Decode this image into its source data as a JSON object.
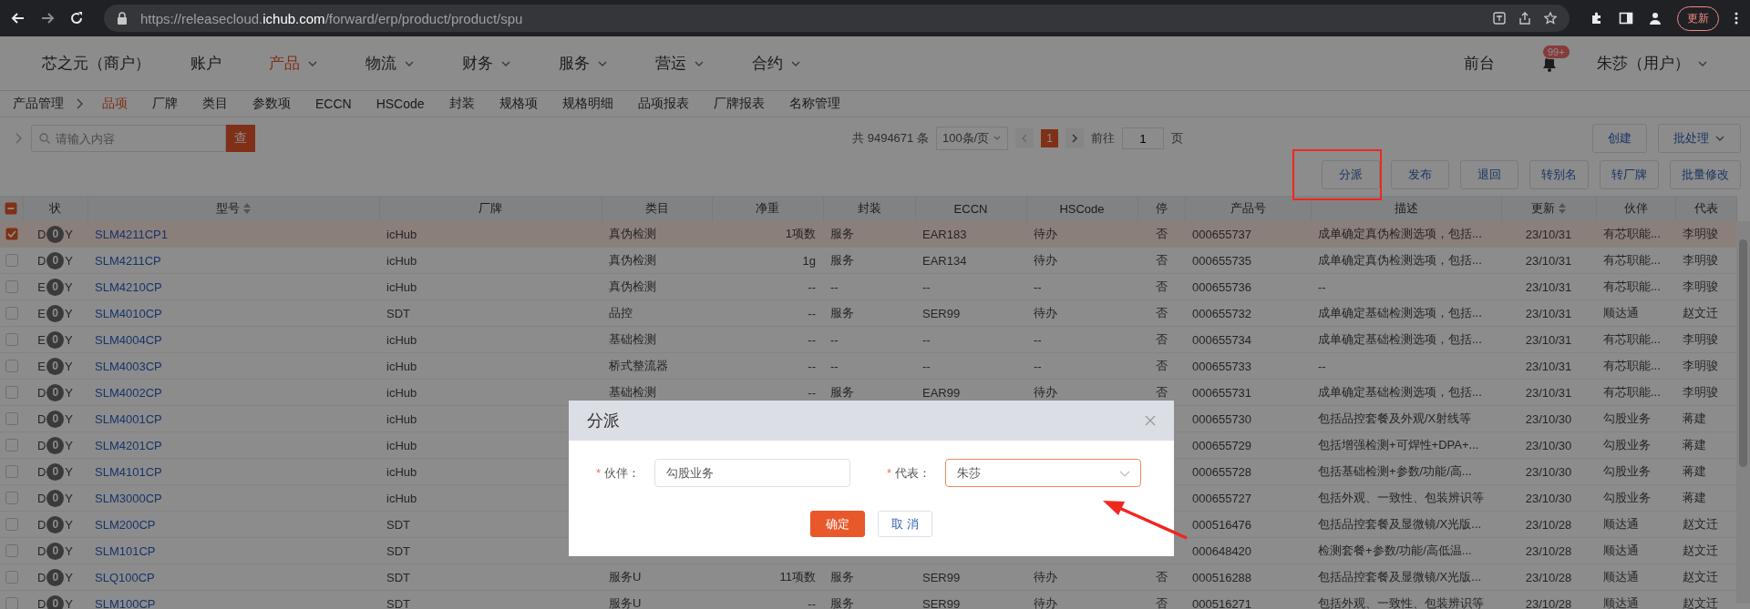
{
  "browser": {
    "url_host": "https://releasecloud.",
    "url_domain": "ichub.com",
    "url_path": "/forward/erp/product/product/spu",
    "update_button": "更新"
  },
  "nav": {
    "brand": "芯之元（商户）",
    "items": [
      {
        "label": "账户",
        "selected": false,
        "dropdown": false
      },
      {
        "label": "产品",
        "selected": true,
        "dropdown": true
      },
      {
        "label": "物流",
        "selected": false,
        "dropdown": true
      },
      {
        "label": "财务",
        "selected": false,
        "dropdown": true
      },
      {
        "label": "服务",
        "selected": false,
        "dropdown": true
      },
      {
        "label": "营运",
        "selected": false,
        "dropdown": true
      },
      {
        "label": "合约",
        "selected": false,
        "dropdown": true
      }
    ],
    "front_desk": "前台",
    "notification_badge": "99+",
    "user": "朱莎（用户）"
  },
  "breadcrumb": {
    "root": "产品管理",
    "tabs": [
      {
        "label": "品项",
        "selected": true
      },
      {
        "label": "厂牌",
        "selected": false
      },
      {
        "label": "类目",
        "selected": false
      },
      {
        "label": "参数项",
        "selected": false
      },
      {
        "label": "ECCN",
        "selected": false
      },
      {
        "label": "HSCode",
        "selected": false
      },
      {
        "label": "封装",
        "selected": false
      },
      {
        "label": "规格项",
        "selected": false
      },
      {
        "label": "规格明细",
        "selected": false
      },
      {
        "label": "品项报表",
        "selected": false
      },
      {
        "label": "厂牌报表",
        "selected": false
      },
      {
        "label": "名称管理",
        "selected": false
      }
    ]
  },
  "toolbar": {
    "search": {
      "placeholder": "请输入内容",
      "button": "查"
    },
    "pager": {
      "total": "共 9494671 条",
      "page_size": "100条/页",
      "pages": [
        {
          "label": "1",
          "selected": true
        }
      ],
      "goto_label": "前往",
      "goto_value": "1",
      "goto_suffix": "页"
    },
    "top_buttons": [
      {
        "label": "创建",
        "dropdown": false
      },
      {
        "label": "批处理",
        "dropdown": true
      }
    ],
    "actions": [
      "分派",
      "发布",
      "退回",
      "转别名",
      "转厂牌",
      "批量修改"
    ]
  },
  "table": {
    "header_checkbox": {
      "indeterminate": true
    },
    "columns": [
      {
        "label": "状",
        "sortable": false
      },
      {
        "label": "型号",
        "sortable": true
      },
      {
        "label": "厂牌",
        "sortable": false
      },
      {
        "label": "类目",
        "sortable": false
      },
      {
        "label": "净重",
        "sortable": false
      },
      {
        "label": "封装",
        "sortable": false
      },
      {
        "label": "ECCN",
        "sortable": false
      },
      {
        "label": "HSCode",
        "sortable": false
      },
      {
        "label": "停",
        "sortable": false
      },
      {
        "label": "产品号",
        "sortable": false
      },
      {
        "label": "描述",
        "sortable": false
      },
      {
        "label": "更新",
        "sortable": true
      },
      {
        "label": "伙伴",
        "sortable": false
      },
      {
        "label": "代表",
        "sortable": false
      }
    ],
    "rows": [
      {
        "checked": true,
        "selected": true,
        "status": "D",
        "badge": "0",
        "flag": "Y",
        "model": "SLM4211CP1",
        "brand": "icHub",
        "category": "真伪检测",
        "weight": "1项数",
        "package": "服务",
        "eccn": "EAR183",
        "hscode": "待办",
        "stop": "否",
        "product_no": "000655737",
        "description": "成单确定真伪检测选项，包括...",
        "updated": "23/10/31",
        "partner": "有芯职能...",
        "rep": "李明骏"
      },
      {
        "checked": false,
        "selected": false,
        "status": "D",
        "badge": "0",
        "flag": "Y",
        "model": "SLM4211CP",
        "brand": "icHub",
        "category": "真伪检测",
        "weight": "1g",
        "package": "服务",
        "eccn": "EAR134",
        "hscode": "待办",
        "stop": "否",
        "product_no": "000655735",
        "description": "成单确定真伪检测选项，包括...",
        "updated": "23/10/31",
        "partner": "有芯职能...",
        "rep": "李明骏"
      },
      {
        "checked": false,
        "selected": false,
        "status": "E",
        "badge": "0",
        "flag": "Y",
        "model": "SLM4210CP",
        "brand": "icHub",
        "category": "真伪检测",
        "weight": "--",
        "package": "--",
        "eccn": "--",
        "hscode": "--",
        "stop": "否",
        "product_no": "000655736",
        "description": "--",
        "updated": "23/10/31",
        "partner": "有芯职能...",
        "rep": "李明骏"
      },
      {
        "checked": false,
        "selected": false,
        "status": "E",
        "badge": "0",
        "flag": "Y",
        "model": "SLM4010CP",
        "brand": "SDT",
        "category": "品控",
        "weight": "--",
        "package": "服务",
        "eccn": "SER99",
        "hscode": "待办",
        "stop": "否",
        "product_no": "000655732",
        "description": "成单确定基础检测选项，包括...",
        "updated": "23/10/31",
        "partner": "顺达通",
        "rep": "赵文迁"
      },
      {
        "checked": false,
        "selected": false,
        "status": "E",
        "badge": "0",
        "flag": "Y",
        "model": "SLM4004CP",
        "brand": "icHub",
        "category": "基础检测",
        "weight": "--",
        "package": "--",
        "eccn": "--",
        "hscode": "--",
        "stop": "否",
        "product_no": "000655734",
        "description": "成单确定基础检测选项，包括...",
        "updated": "23/10/31",
        "partner": "有芯职能...",
        "rep": "李明骏"
      },
      {
        "checked": false,
        "selected": false,
        "status": "E",
        "badge": "0",
        "flag": "Y",
        "model": "SLM4003CP",
        "brand": "icHub",
        "category": "桥式整流器",
        "weight": "--",
        "package": "--",
        "eccn": "--",
        "hscode": "--",
        "stop": "否",
        "product_no": "000655733",
        "description": "--",
        "updated": "23/10/31",
        "partner": "有芯职能...",
        "rep": "李明骏"
      },
      {
        "checked": false,
        "selected": false,
        "status": "D",
        "badge": "0",
        "flag": "Y",
        "model": "SLM4002CP",
        "brand": "icHub",
        "category": "基础检测",
        "weight": "--",
        "package": "服务",
        "eccn": "EAR99",
        "hscode": "待办",
        "stop": "否",
        "product_no": "000655731",
        "description": "成单确定基础检测选项，包括...",
        "updated": "23/10/31",
        "partner": "有芯职能...",
        "rep": "李明骏"
      },
      {
        "checked": false,
        "selected": false,
        "status": "D",
        "badge": "0",
        "flag": "Y",
        "model": "SLM4001CP",
        "brand": "icHub",
        "product_no": "000655730",
        "description": "包括品控套餐及外观/X射线等",
        "updated": "23/10/30",
        "partner": "勾股业务",
        "rep": "蒋建"
      },
      {
        "checked": false,
        "selected": false,
        "status": "D",
        "badge": "0",
        "flag": "Y",
        "model": "SLM4201CP",
        "brand": "icHub",
        "product_no": "000655729",
        "description": "包括增强检测+可焊性+DPA+...",
        "updated": "23/10/30",
        "partner": "勾股业务",
        "rep": "蒋建"
      },
      {
        "checked": false,
        "selected": false,
        "status": "D",
        "badge": "0",
        "flag": "Y",
        "model": "SLM4101CP",
        "brand": "icHub",
        "product_no": "000655728",
        "description": "包括基础检测+参数/功能/高...",
        "updated": "23/10/30",
        "partner": "勾股业务",
        "rep": "蒋建"
      },
      {
        "checked": false,
        "selected": false,
        "status": "D",
        "badge": "0",
        "flag": "Y",
        "model": "SLM3000CP",
        "brand": "icHub",
        "product_no": "000655727",
        "description": "包括外观、一致性、包装辨识等",
        "updated": "23/10/30",
        "partner": "勾股业务",
        "rep": "蒋建"
      },
      {
        "checked": false,
        "selected": false,
        "status": "D",
        "badge": "0",
        "flag": "Y",
        "model": "SLM200CP",
        "brand": "SDT",
        "product_no": "000516476",
        "description": "包括品控套餐及显微镜/X光版...",
        "updated": "23/10/28",
        "partner": "顺达通",
        "rep": "赵文迁"
      },
      {
        "checked": false,
        "selected": false,
        "status": "D",
        "badge": "0",
        "flag": "Y",
        "model": "SLM101CP",
        "brand": "SDT",
        "product_no": "000648420",
        "description": "检测套餐+参数/功能/高低温...",
        "updated": "23/10/28",
        "partner": "顺达通",
        "rep": "赵文迁"
      },
      {
        "checked": false,
        "selected": false,
        "status": "D",
        "badge": "0",
        "flag": "Y",
        "model": "SLQ100CP",
        "brand": "SDT",
        "category": "服务U",
        "weight": "11项数",
        "package": "服务",
        "eccn": "SER99",
        "hscode": "待办",
        "stop": "否",
        "product_no": "000516288",
        "description": "包括品控套餐及显微镜/X光版...",
        "updated": "23/10/28",
        "partner": "顺达通",
        "rep": "赵文迁"
      },
      {
        "checked": false,
        "selected": false,
        "status": "D",
        "badge": "0",
        "flag": "Y",
        "model": "SLM100CP",
        "brand": "SDT",
        "category": "服务U",
        "weight": "--",
        "package": "服务",
        "eccn": "SER99",
        "hscode": "待办",
        "stop": "否",
        "product_no": "000516271",
        "description": "包括外观、一致性、包装辨识等",
        "updated": "23/10/28",
        "partner": "顺达通",
        "rep": "赵文迁"
      }
    ]
  },
  "dialog": {
    "title": "分派",
    "fields": [
      {
        "kind": "input",
        "required_mark": "*",
        "label": "伙伴：",
        "value": "勾股业务",
        "focused": false
      },
      {
        "kind": "select",
        "required_mark": "*",
        "label": "代表：",
        "value": "朱莎",
        "focused": true
      }
    ],
    "buttons": [
      {
        "kind": "primary",
        "label": "确定"
      },
      {
        "kind": "default",
        "label": "取 消"
      }
    ]
  }
}
